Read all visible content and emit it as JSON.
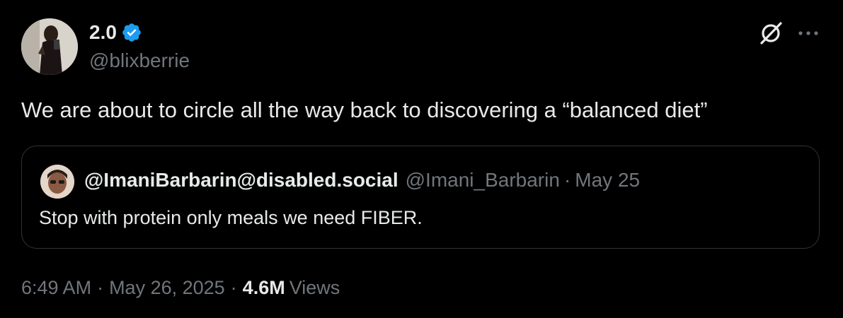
{
  "author": {
    "display_name": "2.0",
    "handle": "@blixberrie",
    "verified": true,
    "verified_color": "#1d9bf0",
    "avatar_icon": "profile-photo"
  },
  "toolbar": {
    "grok_icon": "grok-icon",
    "more_icon": "more-icon"
  },
  "tweet": {
    "text": "We are about to circle all the way back to discovering a “balanced diet”"
  },
  "quote": {
    "name": "@ImaniBarbarin@disabled.social",
    "handle": "@Imani_Barbarin",
    "separator": "·",
    "date": "May 25",
    "text": "Stop with protein only meals we need FIBER."
  },
  "meta": {
    "time": "6:49 AM",
    "separator": "·",
    "date": "May 26, 2025",
    "views_count": "4.6M",
    "views_label": "Views"
  },
  "colors": {
    "background": "#000000",
    "primary_text": "#e7e9ea",
    "secondary_text": "#71767b",
    "border": "#2f3336"
  }
}
